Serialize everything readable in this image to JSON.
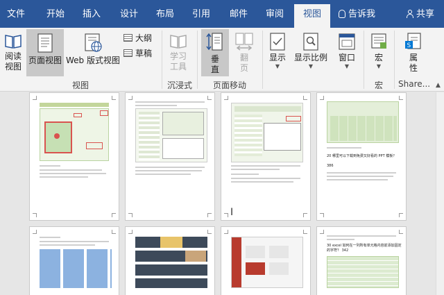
{
  "tabs": {
    "file": "文件",
    "home": "开始",
    "insert": "插入",
    "design": "设计",
    "layout": "布局",
    "references": "引用",
    "mailings": "邮件",
    "review": "审阅",
    "view": "视图",
    "tell_me": "告诉我",
    "share": "共享"
  },
  "ribbon": {
    "read_mode": "阅读视图",
    "read_mode_l1": "阅读",
    "read_mode_l2": "视图",
    "print_layout": "页面视图",
    "web_layout": "Web 版式视图",
    "outline": "大纲",
    "draft": "草稿",
    "views_group": "视图",
    "learning_tools_l1": "学习",
    "learning_tools_l2": "工具",
    "immersive_group": "沉浸式",
    "vertical_l1": "垂",
    "vertical_l2": "直",
    "side_by_side_l1": "翻",
    "side_by_side_l2": "页",
    "page_movement_group": "页面移动",
    "show": "显示",
    "zoom": "显示比例",
    "window": "窗口",
    "macros": "宏",
    "macros_group": "宏",
    "properties_l1": "属",
    "properties_l2": "性",
    "sharepoint_group": "Share..."
  },
  "colors": {
    "title_bar": "#2b579a",
    "ribbon_bg": "#f3f3f3",
    "doc_bg": "#e6e6e6",
    "accent_green": "#70ad47"
  },
  "page_text": {
    "p4_heading": "20 哪里可以下载到免费又好看的 PPT 模板？",
    "p4_heading_num": "386",
    "p8_heading": "30 excel 如何在一列所有单元格内容前添加固定的字符？ 342"
  }
}
